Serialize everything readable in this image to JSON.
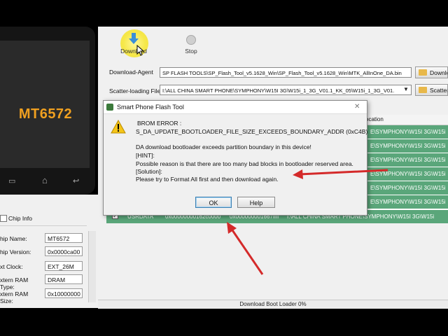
{
  "phone": {
    "chip": "MT6572",
    "nav": [
      "▭",
      "⌂",
      "↩"
    ]
  },
  "chip_info": {
    "title": "Chip Info",
    "rows": [
      {
        "label": "hip Name:",
        "value": "MT6572"
      },
      {
        "label": "hip Version:",
        "value": "0x0000ca00"
      },
      {
        "label": "xt Clock:",
        "value": "EXT_26M"
      },
      {
        "label": "xtern RAM Type:",
        "value": "DRAM"
      },
      {
        "label": "xtern RAM Size:",
        "value": "0x10000000"
      }
    ]
  },
  "toolbar": {
    "download_label": "Download",
    "stop_label": "Stop"
  },
  "fields": {
    "download_agent_label": "Download-Agent",
    "download_agent_value": "SP FLASH TOOLS\\SP_Flash_Tool_v5.1628_Win\\SP_Flash_Tool_v5.1628_Win\\MTK_AllInOne_DA.bin",
    "download_agent_button": "Downlo",
    "scatter_label": "Scatter-loading File",
    "scatter_value": "I:\\ALL CHINA SMART PHONE\\SYMPHONY\\W15I 3G\\W15i_1_3G_V01.1_KK_05\\W15i_1_3G_V01.",
    "scatter_button": "Scatter"
  },
  "table": {
    "location_header": "ocation",
    "rows": [
      "E\\SYMPHONY\\W15I 3G\\W15i",
      "E\\SYMPHONY\\W15I 3G\\W15i",
      "E\\SYMPHONY\\W15I 3G\\W15i",
      "E\\SYMPHONY\\W15I 3G\\W15i",
      "E\\SYMPHONY\\W15I 3G\\W15i",
      "E\\SYMPHONY\\W15I 3G\\W15i"
    ],
    "last_row": {
      "name": "USRDATA",
      "begin": "0x00000000162c0000",
      "end": "0x000000001667ffff",
      "location": "I:\\ALL CHINA SMART PHONE\\SYMPHONY\\W15I 3G\\W15i"
    }
  },
  "status": {
    "text": "Download Boot Loader 0%"
  },
  "dialog": {
    "title": "Smart Phone Flash Tool",
    "close": "✕",
    "lines": [
      "BROM ERROR :",
      "S_DA_UPDATE_BOOTLOADER_FILE_SIZE_EXCEEDS_BOUNDARY_ADDR (0xC4B)",
      "DA download bootloader exceeds partition boundary in this device!",
      "[HINT]:",
      "Possible reason is that there are too many bad blocks in bootloader reserved area.",
      "[Solution]:",
      "Please try to Format All first and then download again."
    ],
    "ok_label": "OK",
    "help_label": "Help"
  },
  "colors": {
    "accent_red": "#d42a2a",
    "row_green": "#5aa67a",
    "chip_orange": "#f0a020"
  }
}
